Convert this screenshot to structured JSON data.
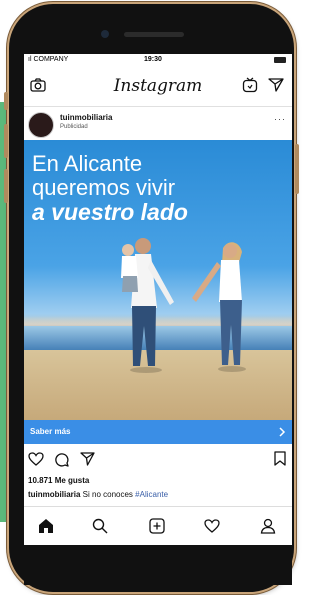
{
  "status_bar": {
    "carrier": "ıl COMPANY",
    "time": "19:30"
  },
  "header": {
    "logo": "Instagram",
    "left_icon": "camera-icon",
    "right_icons": [
      "igtv-icon",
      "direct-send-icon"
    ]
  },
  "post": {
    "username": "tuinmobiliaria",
    "sponsored_label": "Publicidad",
    "more_icon": "more-options-icon",
    "headline": {
      "line1": "En Alicante",
      "line2": "queremos vivir",
      "line3": "a vuestro lado"
    },
    "cta_label": "Saber más",
    "likes": "10.871 Me gusta",
    "caption_user": "tuinmobiliaria",
    "caption_text": " Si no conoces ",
    "caption_tag": "#Alicante"
  },
  "actions": [
    "like-icon",
    "comment-icon",
    "share-icon",
    "save-icon"
  ],
  "bottom_nav": [
    "home-icon",
    "search-icon",
    "new-post-icon",
    "activity-icon",
    "profile-icon"
  ],
  "colors": {
    "accent_green": "#5bb97b",
    "cta_blue": "#3a8ee6",
    "phone_gold": "#c9a57a"
  }
}
